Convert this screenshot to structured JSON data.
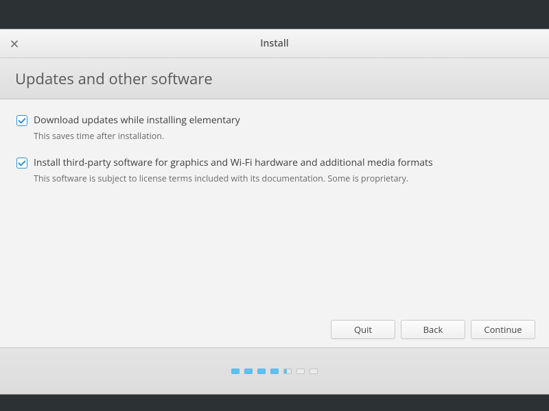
{
  "window": {
    "title": "Install"
  },
  "header": {
    "title": "Updates and other software"
  },
  "options": {
    "download_updates": {
      "checked": true,
      "label": "Download updates while installing elementary",
      "description": "This saves time after installation."
    },
    "third_party": {
      "checked": true,
      "label": "Install third-party software for graphics and Wi-Fi hardware and additional media formats",
      "description": "This software is subject to license terms included with its documentation. Some is proprietary."
    }
  },
  "buttons": {
    "quit": "Quit",
    "back": "Back",
    "continue": "Continue"
  },
  "progress": {
    "total": 7,
    "current": 5
  }
}
